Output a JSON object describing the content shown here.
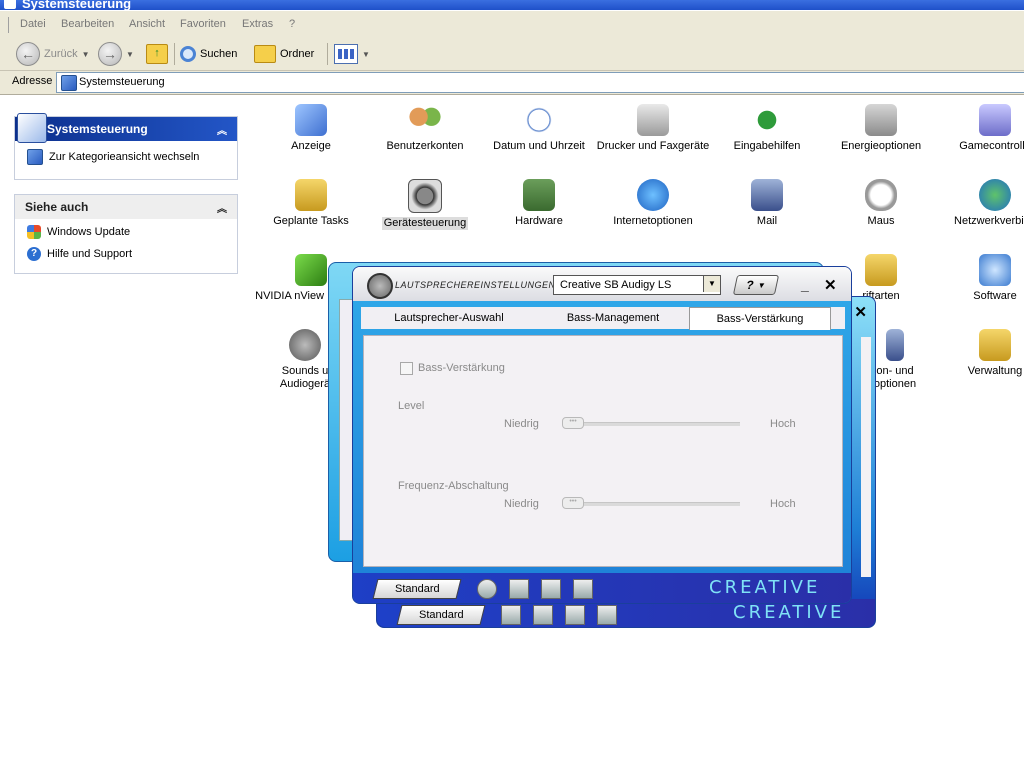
{
  "window": {
    "title": "Systemsteuerung"
  },
  "menu": [
    "Datei",
    "Bearbeiten",
    "Ansicht",
    "Favoriten",
    "Extras",
    "?"
  ],
  "toolbar": {
    "back": "Zurück",
    "search": "Suchen",
    "folders": "Ordner"
  },
  "address": {
    "label": "Adresse",
    "value": "Systemsteuerung"
  },
  "left_pane": {
    "control_panel": {
      "title": "Systemsteuerung",
      "switch_view": "Zur Kategorieansicht wechseln"
    },
    "see_also": {
      "title": "Siehe auch",
      "items": [
        "Windows Update",
        "Hilfe und Support"
      ]
    }
  },
  "icons": {
    "row1": [
      "Anzeige",
      "Benutzerkonten",
      "Datum und Uhrzeit",
      "Drucker und Faxgeräte",
      "Eingabehilfen",
      "Energieoptionen",
      "Gamecontrolle"
    ],
    "row2": [
      "Geplante Tasks",
      "Gerätesteuerung",
      "Hardware",
      "Internetoptionen",
      "Mail",
      "Maus",
      "Netzwerkverbind"
    ],
    "row3": [
      "NVIDIA nView Manage",
      "riftarten",
      "Software"
    ],
    "row4": [
      "Sounds u Audiogerä",
      "on- und optionen",
      "Verwaltung"
    ]
  },
  "creative": {
    "title": "LAUTSPRECHEREINSTELLUNGEN",
    "device": "Creative SB Audigy LS",
    "help": "?",
    "tabs": [
      "Lautsprecher-Auswahl",
      "Bass-Management",
      "Bass-Verstärkung"
    ],
    "active_tab": 2,
    "checkbox": "Bass-Verstärkung",
    "level": {
      "label": "Level",
      "low": "Niedrig",
      "high": "Hoch",
      "value": 0
    },
    "freq": {
      "label": "Frequenz-Abschaltung",
      "low": "Niedrig",
      "high": "Hoch",
      "value": 0
    },
    "standard": "Standard",
    "brand": "CREATIVE",
    "back_standard": "Standard",
    "back_brand": "CREATIVE"
  },
  "colors": {
    "accent": "#2356c7",
    "creative_blue": "#1e3fc6",
    "brand_text": "#7fe2f6"
  }
}
